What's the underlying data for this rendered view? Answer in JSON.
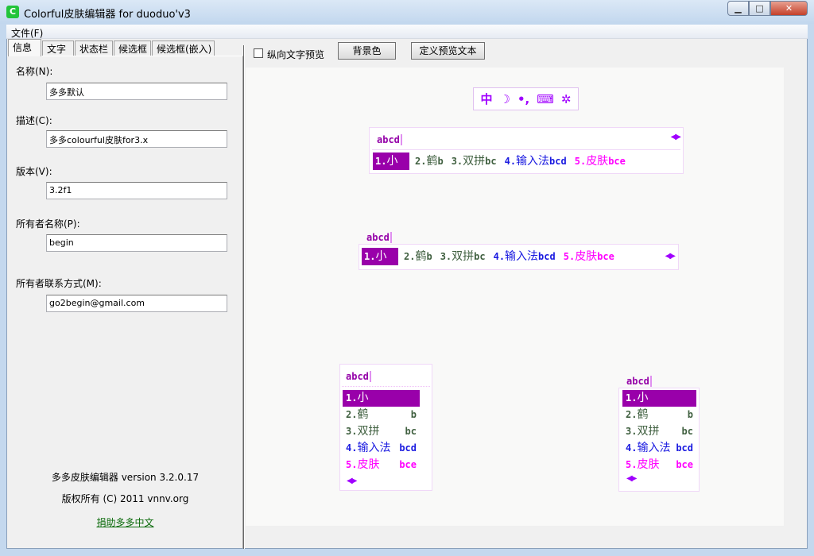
{
  "window": {
    "title": "Colorful皮肤编辑器 for duoduo'v3",
    "icon_letter": "C"
  },
  "menu": {
    "file": "文件(F)"
  },
  "tabs": [
    {
      "label": "信息",
      "active": true
    },
    {
      "label": "文字"
    },
    {
      "label": "状态栏"
    },
    {
      "label": "候选框"
    },
    {
      "label": "候选框(嵌入)"
    }
  ],
  "info": {
    "name_label": "名称(N):",
    "name_value": "多多默认",
    "desc_label": "描述(C):",
    "desc_value": "多多colourful皮肤for3.x",
    "version_label": "版本(V):",
    "version_value": "3.2f1",
    "owner_label": "所有者名称(P):",
    "owner_value": "begin",
    "contact_label": "所有者联系方式(M):",
    "contact_value": "go2begin@gmail.com",
    "about_version": "多多皮肤编辑器 version 3.2.0.17",
    "copyright": "版权所有 (C) 2011 vnnv.org",
    "donate_link": "捐助多多中文"
  },
  "toolbar": {
    "vertical_preview": "纵向文字预览",
    "vertical_checked": false,
    "bg_color": "背景色",
    "define_text": "定义预览文本"
  },
  "preview": {
    "composition": "abcd",
    "status_icons": [
      "中",
      "☽",
      "•,",
      "⌨",
      "✲"
    ],
    "arrows": "◀▶",
    "candidates": [
      {
        "num": "1.",
        "word": "小",
        "code": "",
        "color": "#ffffff",
        "selected": true
      },
      {
        "num": "2.",
        "word": "鹤",
        "code": "b",
        "color": "#406040"
      },
      {
        "num": "3.",
        "word": "双拼",
        "code": "bc",
        "color": "#406040"
      },
      {
        "num": "4.",
        "word": "输入法",
        "code": "bcd",
        "color": "#1a1ae0"
      },
      {
        "num": "5.",
        "word": "皮肤",
        "code": "bce",
        "color": "#ff00ff"
      }
    ],
    "highlight_color": "#9900aa"
  }
}
